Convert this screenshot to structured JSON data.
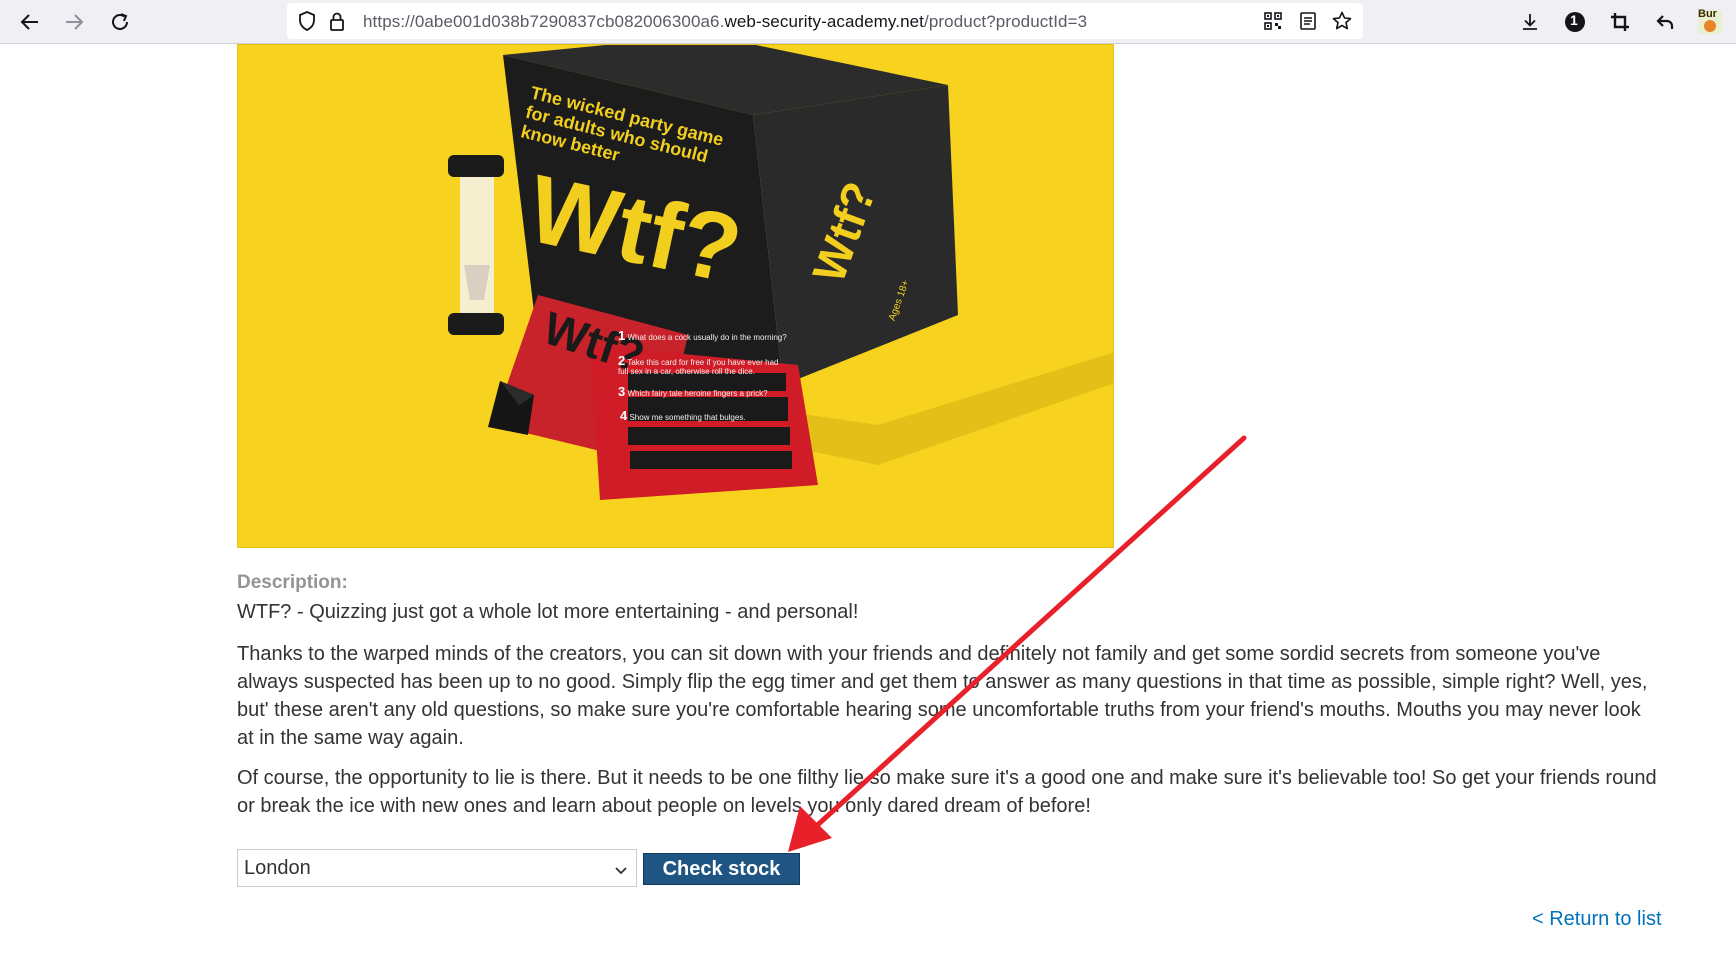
{
  "browser": {
    "url_prefix": "https://0abe001d038b7290837cb082006300a6.",
    "url_domain": "web-security-academy.net",
    "url_path": "/product?productId=3",
    "badge_count": "1",
    "extension_label": "Bur"
  },
  "product_image": {
    "box_title": "Wtf?",
    "box_text": "The wicked party game for adults who should know better",
    "side_box_title": "Wtf?",
    "age_note": "Ages 18+",
    "card_title": "Wtf?",
    "card_items": [
      {
        "num": "1",
        "text": "What does a cock usually do in the morning?"
      },
      {
        "num": "2",
        "text": "Take this card for free if you have ever had full sex in a car, otherwise roll the dice."
      },
      {
        "num": "3",
        "text": "Which fairy tale heroine fingers a prick?"
      },
      {
        "num": "4",
        "text": "Show me something that bulges."
      }
    ]
  },
  "description": {
    "label": "Description:",
    "lead": "WTF? - Quizzing just got a whole lot more entertaining - and personal!",
    "p1": "Thanks to the warped minds of the creators, you can sit down with your friends and definitely not family and get some sordid secrets from someone you've always suspected has been up to no good. Simply flip the egg timer and get them to answer as many questions in that time as possible, simple right? Well, yes, but' these aren't any old questions, so make sure you're comfortable hearing some uncomfortable truths from your friend's mouths. Mouths you may never look at in the same way again.",
    "p2": "Of course, the opportunity to lie is there. But it needs to be one filthy lie so make sure it's a good one and make sure it's believable too! So get your friends round or break the ice with new ones and learn about people on levels you only dared dream of before!"
  },
  "stock": {
    "selected_store": "London",
    "button_label": "Check stock"
  },
  "return_link": "< Return to list",
  "colors": {
    "button_bg": "#1f5582",
    "link": "#0071bc",
    "image_bg": "#f7d21e",
    "arrow": "#e8202a"
  }
}
